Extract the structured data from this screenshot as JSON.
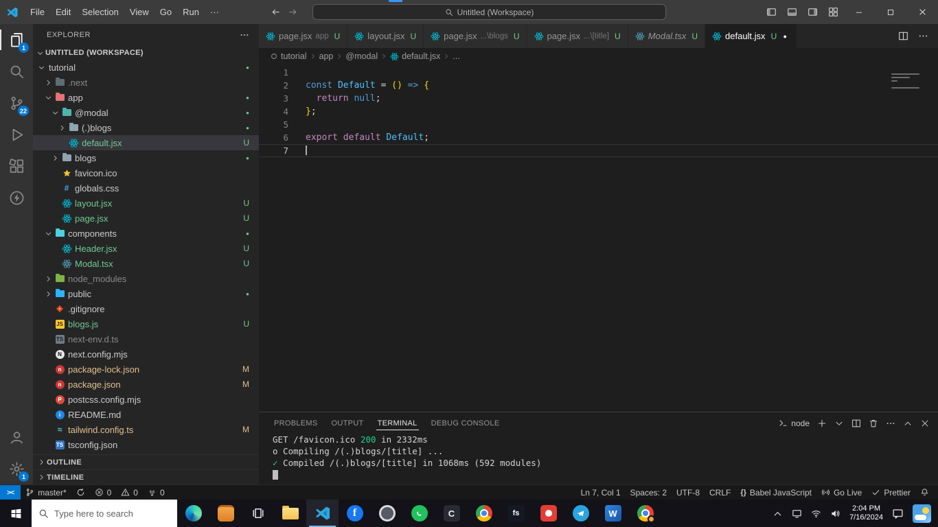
{
  "window": {
    "title": "Untitled (Workspace)",
    "menu": [
      "File",
      "Edit",
      "Selection",
      "View",
      "Go",
      "Run",
      "···"
    ],
    "layout_controls": [
      "toggle-primary-sidebar",
      "toggle-panel",
      "toggle-secondary-sidebar",
      "customize-layout"
    ],
    "window_controls": [
      "minimize",
      "maximize",
      "close"
    ]
  },
  "activity_bar": {
    "top": [
      {
        "name": "explorer",
        "active": true,
        "badge": "1"
      },
      {
        "name": "search"
      },
      {
        "name": "source-control",
        "badge": "22"
      },
      {
        "name": "run-and-debug"
      },
      {
        "name": "extensions"
      },
      {
        "name": "thunder-client"
      }
    ],
    "bottom": [
      {
        "name": "accounts"
      },
      {
        "name": "settings",
        "badge": "1"
      }
    ]
  },
  "explorer": {
    "title": "EXPLORER",
    "workspace_label": "UNTITLED (WORKSPACE)",
    "outline_label": "OUTLINE",
    "timeline_label": "TIMELINE",
    "tree": [
      {
        "label": "tutorial",
        "level": 0,
        "type": "folder",
        "expanded": true,
        "badge": "dot"
      },
      {
        "label": ".next",
        "level": 1,
        "type": "folder",
        "expanded": false,
        "dim": true,
        "icon": {
          "t": "folder",
          "c": "#5d6d75"
        }
      },
      {
        "label": "app",
        "level": 1,
        "type": "folder",
        "expanded": true,
        "badge": "dot",
        "icon": {
          "t": "folder",
          "c": "#e57373"
        }
      },
      {
        "label": "@modal",
        "level": 2,
        "type": "folder",
        "expanded": true,
        "badge": "dot",
        "icon": {
          "t": "folder",
          "c": "#4db6ac"
        }
      },
      {
        "label": "(.)blogs",
        "level": 3,
        "type": "folder",
        "expanded": false,
        "badge": "dot",
        "icon": {
          "t": "folder",
          "c": "#90a4ae"
        }
      },
      {
        "label": "default.jsx",
        "level": 3,
        "type": "file",
        "selected": true,
        "badge": "U",
        "icon": {
          "t": "atom",
          "c": "#00bcd4"
        }
      },
      {
        "label": "blogs",
        "level": 2,
        "type": "folder",
        "expanded": false,
        "badge": "dot",
        "icon": {
          "t": "folder",
          "c": "#90a4ae"
        }
      },
      {
        "label": "favicon.ico",
        "level": 2,
        "type": "file",
        "icon": {
          "t": "star",
          "c": "#fbc02d"
        }
      },
      {
        "label": "globals.css",
        "level": 2,
        "type": "file",
        "icon": {
          "t": "glyph",
          "ch": "#",
          "c": "#42a5f5"
        }
      },
      {
        "label": "layout.jsx",
        "level": 2,
        "type": "file",
        "badge": "U",
        "icon": {
          "t": "atom",
          "c": "#00bcd4"
        }
      },
      {
        "label": "page.jsx",
        "level": 2,
        "type": "file",
        "badge": "U",
        "icon": {
          "t": "atom",
          "c": "#00bcd4"
        }
      },
      {
        "label": "components",
        "level": 1,
        "type": "folder",
        "expanded": true,
        "badge": "dot",
        "icon": {
          "t": "folder",
          "c": "#4dd0e1"
        }
      },
      {
        "label": "Header.jsx",
        "level": 2,
        "type": "file",
        "badge": "U",
        "icon": {
          "t": "atom",
          "c": "#00bcd4"
        }
      },
      {
        "label": "Modal.tsx",
        "level": 2,
        "type": "file",
        "badge": "U",
        "icon": {
          "t": "atom",
          "c": "#519aba"
        }
      },
      {
        "label": "node_modules",
        "level": 1,
        "type": "folder",
        "expanded": false,
        "dim": true,
        "icon": {
          "t": "folder",
          "c": "#7cb342"
        }
      },
      {
        "label": "public",
        "level": 1,
        "type": "folder",
        "expanded": false,
        "badge": "dot",
        "icon": {
          "t": "folder",
          "c": "#29b6f6"
        }
      },
      {
        "label": ".gitignore",
        "level": 1,
        "type": "file",
        "icon": {
          "t": "git",
          "c": "#e64a19"
        }
      },
      {
        "label": "blogs.js",
        "level": 1,
        "type": "file",
        "badge": "U",
        "icon": {
          "t": "box",
          "txt": "JS",
          "bg": "#ffca28",
          "fg": "#2d2d2d"
        }
      },
      {
        "label": "next-env.d.ts",
        "level": 1,
        "type": "file",
        "dim": true,
        "icon": {
          "t": "box",
          "txt": "TS",
          "bg": "#6e7a84",
          "fg": "#1e1e1e"
        }
      },
      {
        "label": "next.config.mjs",
        "level": 1,
        "type": "file",
        "icon": {
          "t": "circle",
          "txt": "N",
          "bg": "#e8e8e8",
          "fg": "#111111"
        }
      },
      {
        "label": "package-lock.json",
        "level": 1,
        "type": "file",
        "badge": "M",
        "icon": {
          "t": "circle",
          "txt": "n",
          "bg": "#cb3837",
          "fg": "#ffffff"
        }
      },
      {
        "label": "package.json",
        "level": 1,
        "type": "file",
        "badge": "M",
        "icon": {
          "t": "circle",
          "txt": "n",
          "bg": "#cb3837",
          "fg": "#ffffff"
        }
      },
      {
        "label": "postcss.config.mjs",
        "level": 1,
        "type": "file",
        "icon": {
          "t": "circle",
          "txt": "P",
          "bg": "#dd4b39",
          "fg": "#ffffff"
        }
      },
      {
        "label": "README.md",
        "level": 1,
        "type": "file",
        "icon": {
          "t": "circle",
          "txt": "i",
          "bg": "#1e88e5",
          "fg": "#ffffff"
        }
      },
      {
        "label": "tailwind.config.ts",
        "level": 1,
        "type": "file",
        "badge": "M",
        "icon": {
          "t": "glyph",
          "ch": "≈",
          "c": "#4dd0e1"
        }
      },
      {
        "label": "tsconfig.json",
        "level": 1,
        "type": "file",
        "icon": {
          "t": "box",
          "txt": "TS",
          "bg": "#3178c6",
          "fg": "#ffffff"
        }
      }
    ]
  },
  "tabs": {
    "items": [
      {
        "name": "page.jsx",
        "desc": "app",
        "badge": "U",
        "icon_color": "#00bcd4"
      },
      {
        "name": "layout.jsx",
        "desc": "",
        "badge": "U",
        "icon_color": "#00bcd4"
      },
      {
        "name": "page.jsx",
        "desc": "...\\blogs",
        "badge": "U",
        "icon_color": "#00bcd4"
      },
      {
        "name": "page.jsx",
        "desc": "...\\[title]",
        "badge": "U",
        "icon_color": "#00bcd4"
      },
      {
        "name": "Modal.tsx",
        "desc": "",
        "badge": "U",
        "italic": true,
        "icon_color": "#519aba"
      },
      {
        "name": "default.jsx",
        "desc": "",
        "badge": "U",
        "active": true,
        "dirty": true,
        "icon_color": "#00bcd4"
      }
    ]
  },
  "breadcrumb": {
    "items": [
      {
        "label": "tutorial"
      },
      {
        "label": "app"
      },
      {
        "label": "@modal"
      },
      {
        "label": "default.jsx",
        "icon": {
          "t": "atom",
          "c": "#00bcd4"
        }
      },
      {
        "label": "..."
      }
    ]
  },
  "editor": {
    "token_colors": {
      "kw": "#569cd6",
      "ctrl": "#c586c0",
      "var": "#4fc1ff",
      "br": "#ffd700",
      "pl": "#d4d4d4",
      "grn": "#23d18b"
    },
    "active_line": 7,
    "cursor_line": 7,
    "lines": [
      {
        "n": 1,
        "seg": []
      },
      {
        "n": 2,
        "seg": [
          [
            "const ",
            "kw"
          ],
          [
            "Default",
            "var"
          ],
          [
            " = ",
            "pl"
          ],
          [
            "()",
            "br"
          ],
          [
            " => ",
            "kw"
          ],
          [
            "{",
            "br"
          ]
        ]
      },
      {
        "n": 3,
        "seg": [
          [
            "  ",
            "pl"
          ],
          [
            "return",
            "ctrl"
          ],
          [
            " ",
            "pl"
          ],
          [
            "null",
            "kw"
          ],
          [
            ";",
            "pl"
          ]
        ]
      },
      {
        "n": 4,
        "seg": [
          [
            "}",
            "br"
          ],
          [
            ";",
            "pl"
          ]
        ]
      },
      {
        "n": 5,
        "seg": []
      },
      {
        "n": 6,
        "seg": [
          [
            "export",
            "ctrl"
          ],
          [
            " ",
            "pl"
          ],
          [
            "default",
            "ctrl"
          ],
          [
            " ",
            "pl"
          ],
          [
            "Default",
            "var"
          ],
          [
            ";",
            "pl"
          ]
        ]
      },
      {
        "n": 7,
        "seg": []
      }
    ]
  },
  "panel": {
    "tabs": [
      "PROBLEMS",
      "OUTPUT",
      "TERMINAL",
      "DEBUG CONSOLE"
    ],
    "active_tab": "TERMINAL",
    "shell_label": "node",
    "terminal": [
      {
        "seg": [
          [
            "GET /favicon.ico ",
            "pl"
          ],
          [
            "200",
            "grn"
          ],
          [
            " in 2332ms",
            "pl"
          ]
        ]
      },
      {
        "seg": [
          [
            "o Compiling /(.)blogs/[title] ...",
            "pl"
          ]
        ]
      },
      {
        "seg": [
          [
            "✓",
            "grn"
          ],
          [
            " Compiled /(.)blogs/[title] in 1068ms (592 modules)",
            "pl"
          ]
        ]
      },
      {
        "seg": [],
        "cursor": true
      }
    ]
  },
  "status_bar": {
    "left": [
      {
        "name": "remote-indicator",
        "text": "><",
        "accent": true
      },
      {
        "name": "git-branch",
        "icon": "branch",
        "label": "master*"
      },
      {
        "name": "sync-changes",
        "icon": "sync"
      },
      {
        "name": "errors",
        "icon": "err",
        "label": "0"
      },
      {
        "name": "warnings",
        "icon": "warn",
        "label": "0"
      },
      {
        "name": "ports",
        "icon": "radio",
        "label": "0"
      }
    ],
    "right": [
      {
        "name": "cursor-position",
        "label": "Ln 7, Col 1"
      },
      {
        "name": "indentation",
        "label": "Spaces: 2"
      },
      {
        "name": "encoding",
        "label": "UTF-8"
      },
      {
        "name": "eol",
        "label": "CRLF"
      },
      {
        "name": "language-mode",
        "icon": "braces",
        "label": "Babel JavaScript"
      },
      {
        "name": "go-live",
        "icon": "cast",
        "label": "Go Live"
      },
      {
        "name": "prettier",
        "icon": "check",
        "label": "Prettier"
      },
      {
        "name": "notifications",
        "icon": "bell"
      }
    ]
  },
  "taskbar": {
    "search_placeholder": "Type here to search",
    "apps": [
      "edge",
      "backpack",
      "task-view",
      "file-explorer",
      "vscode",
      "facebook",
      "browser",
      "whatsapp",
      "c-app",
      "chrome",
      "fs",
      "red-app",
      "telegram",
      "word",
      "chrome-profile"
    ],
    "active_app": "vscode",
    "tray_icons": [
      "chevron-up",
      "monitor",
      "wifi",
      "volume"
    ],
    "clock": {
      "time": "2:04 PM",
      "date": "7/16/2024"
    }
  }
}
